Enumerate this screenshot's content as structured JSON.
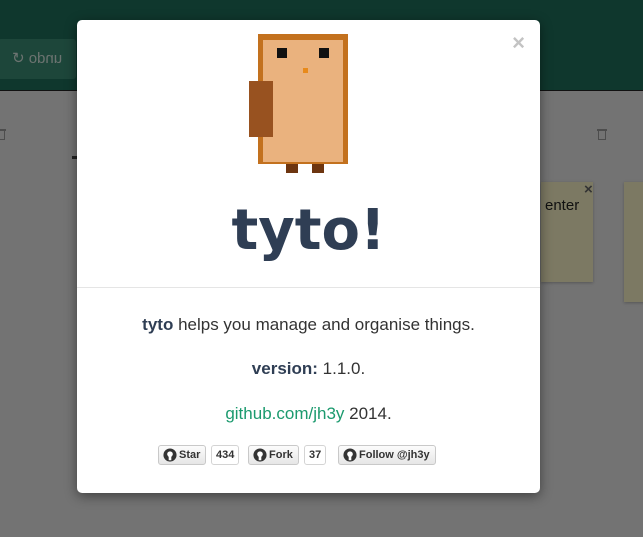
{
  "background": {
    "undo_label": "undo ↺",
    "note_text": "enter",
    "note_close": "×"
  },
  "modal": {
    "close_label": "×",
    "title": "tyto!",
    "description_bold": "tyto",
    "description_rest": " helps you manage and organise things.",
    "version_label": "version:",
    "version_value": " 1.1.0.",
    "github_link": "github.com/jh3y",
    "github_year": " 2014."
  },
  "github_buttons": {
    "star_label": "Star",
    "star_count": "434",
    "fork_label": "Fork",
    "fork_count": "37",
    "follow_label": "Follow @jh3y"
  },
  "colors": {
    "title": "#2f3e54",
    "link": "#1b9a6e",
    "header": "#1e6e5b",
    "overlay": "rgba(0,0,0,0.5)"
  }
}
